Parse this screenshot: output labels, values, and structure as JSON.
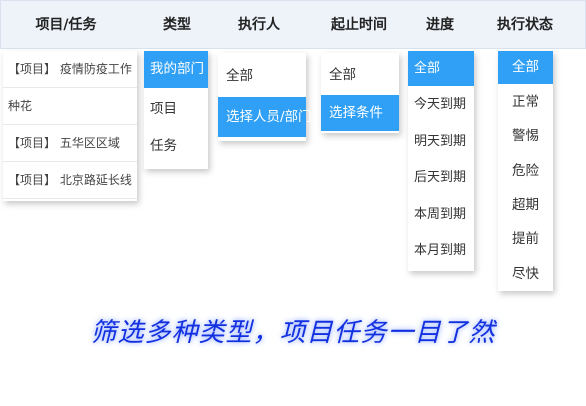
{
  "header": {
    "columns": [
      "项目/任务",
      "类型",
      "执行人",
      "起止时间",
      "进度",
      "执行状态"
    ]
  },
  "project_list": {
    "items": [
      "【项目】 疫情防疫工作",
      "种花",
      "【项目】 五华区区域",
      "【项目】 北京路延长线"
    ]
  },
  "type_filter": {
    "options": [
      "我的部门",
      "项目",
      "任务"
    ],
    "selected": "我的部门"
  },
  "assignee_filter": {
    "options": [
      "全部",
      "选择人员/部门"
    ],
    "selected": "选择人员/部门"
  },
  "date_filter": {
    "options": [
      "全部",
      "选择条件"
    ],
    "selected": "选择条件"
  },
  "progress_filter": {
    "options": [
      "全部",
      "今天到期",
      "明天到期",
      "后天到期",
      "本周到期",
      "本月到期"
    ],
    "selected": "全部"
  },
  "status_filter": {
    "options": [
      "全部",
      "正常",
      "警惕",
      "危险",
      "超期",
      "提前",
      "尽快"
    ],
    "selected": "全部"
  },
  "slogan": "筛选多种类型，项目任务一目了然",
  "colors": {
    "accent": "#2fa0f5",
    "header_bg": "#eef3fa",
    "slogan": "#1230e0"
  }
}
